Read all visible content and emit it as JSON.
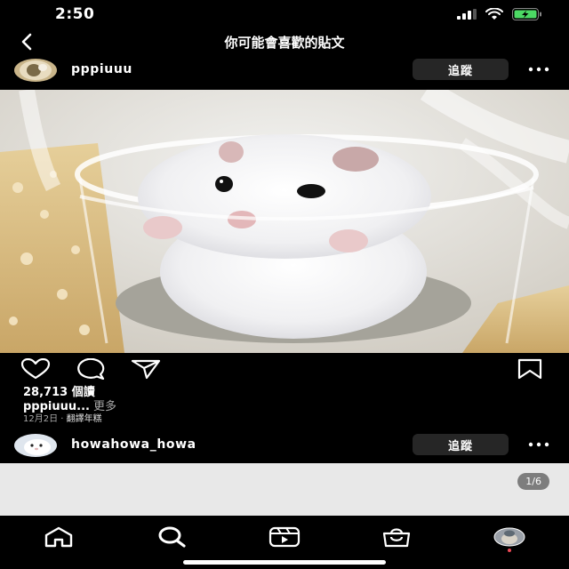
{
  "status_bar": {
    "time": "2:50",
    "icons": [
      "signal-icon",
      "wifi-icon",
      "battery-charging-icon"
    ],
    "battery_color": "#4cd964"
  },
  "header": {
    "back_icon": "chevron-left-icon",
    "title": "你可能會喜歡的貼文"
  },
  "post1": {
    "username": "pppiuuu",
    "follow_label": "追蹤",
    "more_icon": "ellipsis-icon",
    "actions": [
      "heart-icon",
      "comment-icon",
      "send-icon",
      "bookmark-icon"
    ],
    "views": "28,713 個讀",
    "caption_user": "pppiuuu...",
    "caption_more": "更多",
    "date": "12月2日",
    "separator": "·",
    "translate": "翻譯年糕"
  },
  "post2": {
    "username": "howahowa_howa",
    "follow_label": "追蹤",
    "more_icon": "ellipsis-icon",
    "page_counter": "1/6"
  },
  "bottom_nav": {
    "items": [
      "home-icon",
      "search-icon",
      "reels-icon",
      "shop-icon",
      "profile-avatar"
    ],
    "notification_color": "#ed4956"
  },
  "colors": {
    "background": "#000000",
    "button_bg": "#262626",
    "secondary_text": "#a8a8a8"
  }
}
